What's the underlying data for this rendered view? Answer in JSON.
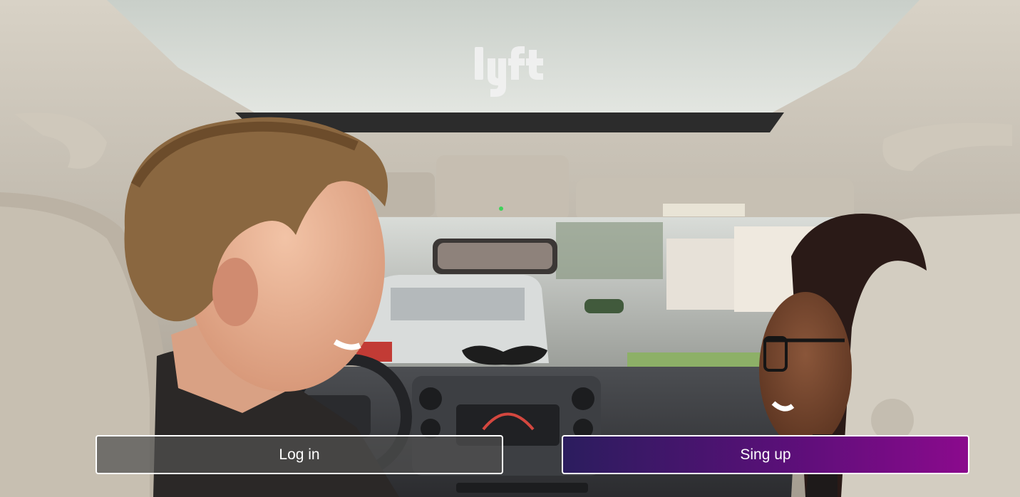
{
  "brand": {
    "logo_text": "lyft",
    "logo_icon": "lyft-logo"
  },
  "auth": {
    "login_label": "Log in",
    "signup_label": "Sing up"
  },
  "colors": {
    "signup_gradient_start": "#2b1d5e",
    "signup_gradient_end": "#8b0a8d",
    "login_background": "rgba(80,80,80,0.72)",
    "button_border": "#ffffff"
  }
}
